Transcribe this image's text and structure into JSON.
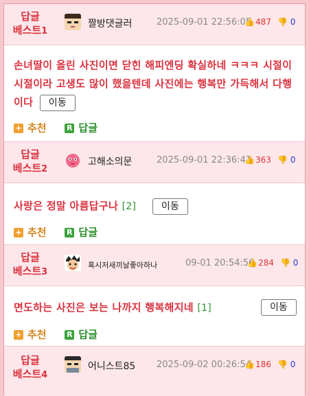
{
  "labels": {
    "rank_prefix": "답글",
    "rank_word": "베스트",
    "recommend": "추천",
    "reply": "답글",
    "move": "이동"
  },
  "entries": [
    {
      "rank": "1",
      "nickname": "짤방댓글러",
      "time": "2025-09-01 22:56:05",
      "up": "487",
      "down": "0",
      "content": "손녀딸이 올린 사진이면 닫힌 해피엔딩 확실하네 ㅋㅋㅋ 시절이 시절이라 고생도 많이 했을텐데 사진에는 행복만 가득해서 다행이다",
      "count": ""
    },
    {
      "rank": "2",
      "nickname": "고해소의문",
      "time": "2025-09-01 22:36:41",
      "up": "363",
      "down": "0",
      "content": "사랑은 정말 아름답구나",
      "count": "[2]"
    },
    {
      "rank": "3",
      "nickname": "혹시저새끼날좋아하나",
      "time": "09-01 20:54:56",
      "up": "284",
      "down": "0",
      "content": "면도하는 사진은 보는 나까지 행복해지네",
      "count": "[1]"
    },
    {
      "rank": "4",
      "nickname": "어니스트85",
      "time": "2025-09-02 00:26:54",
      "up": "186",
      "down": "0",
      "content": "",
      "count": ""
    }
  ],
  "colors": {
    "rank": "#d9333f",
    "content": "#d9333f",
    "time": "#888888",
    "up": "#dd3333",
    "down": "#2a39c9",
    "recommend": "#d38720",
    "reply": "#2d8f2d",
    "header_bg": "#fde7ea",
    "frame": "#f6c9cf"
  },
  "icons": {
    "upvote": "thumbs-up-icon",
    "downvote": "thumbs-down-icon",
    "recommend": "plus-box-icon",
    "reply": "r-box-icon"
  }
}
